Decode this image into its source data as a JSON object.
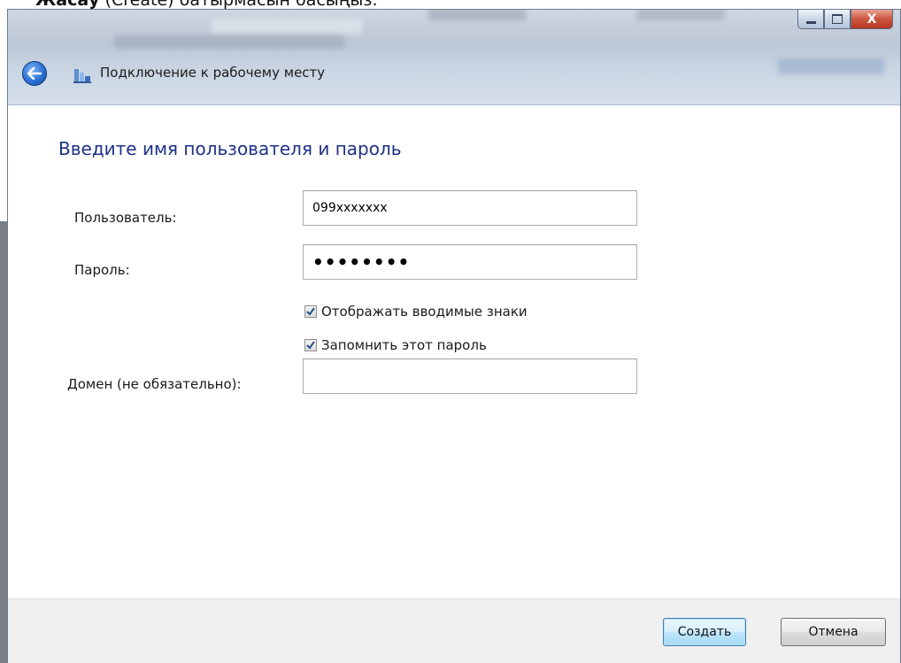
{
  "caption": {
    "bold": "Жасау",
    "rest": " (Create) батырмасын басыңыз."
  },
  "window": {
    "title": "Подключение к рабочему месту",
    "close_glyph": "X"
  },
  "form": {
    "heading": "Введите имя пользователя и пароль",
    "user_label": "Пользователь:",
    "user_value": "099xxxxxxx",
    "password_label": "Пароль:",
    "password_value": "••••••••",
    "show_chars_label": "Отображать вводимые знаки",
    "show_chars_checked": true,
    "remember_label": "Запомнить этот пароль",
    "remember_checked": true,
    "domain_label": "Домен (не обязательно):",
    "domain_value": ""
  },
  "buttons": {
    "create": "Создать",
    "cancel": "Отмена"
  },
  "colors": {
    "heading": "#1e3287",
    "accent": "#3c7fb1"
  }
}
